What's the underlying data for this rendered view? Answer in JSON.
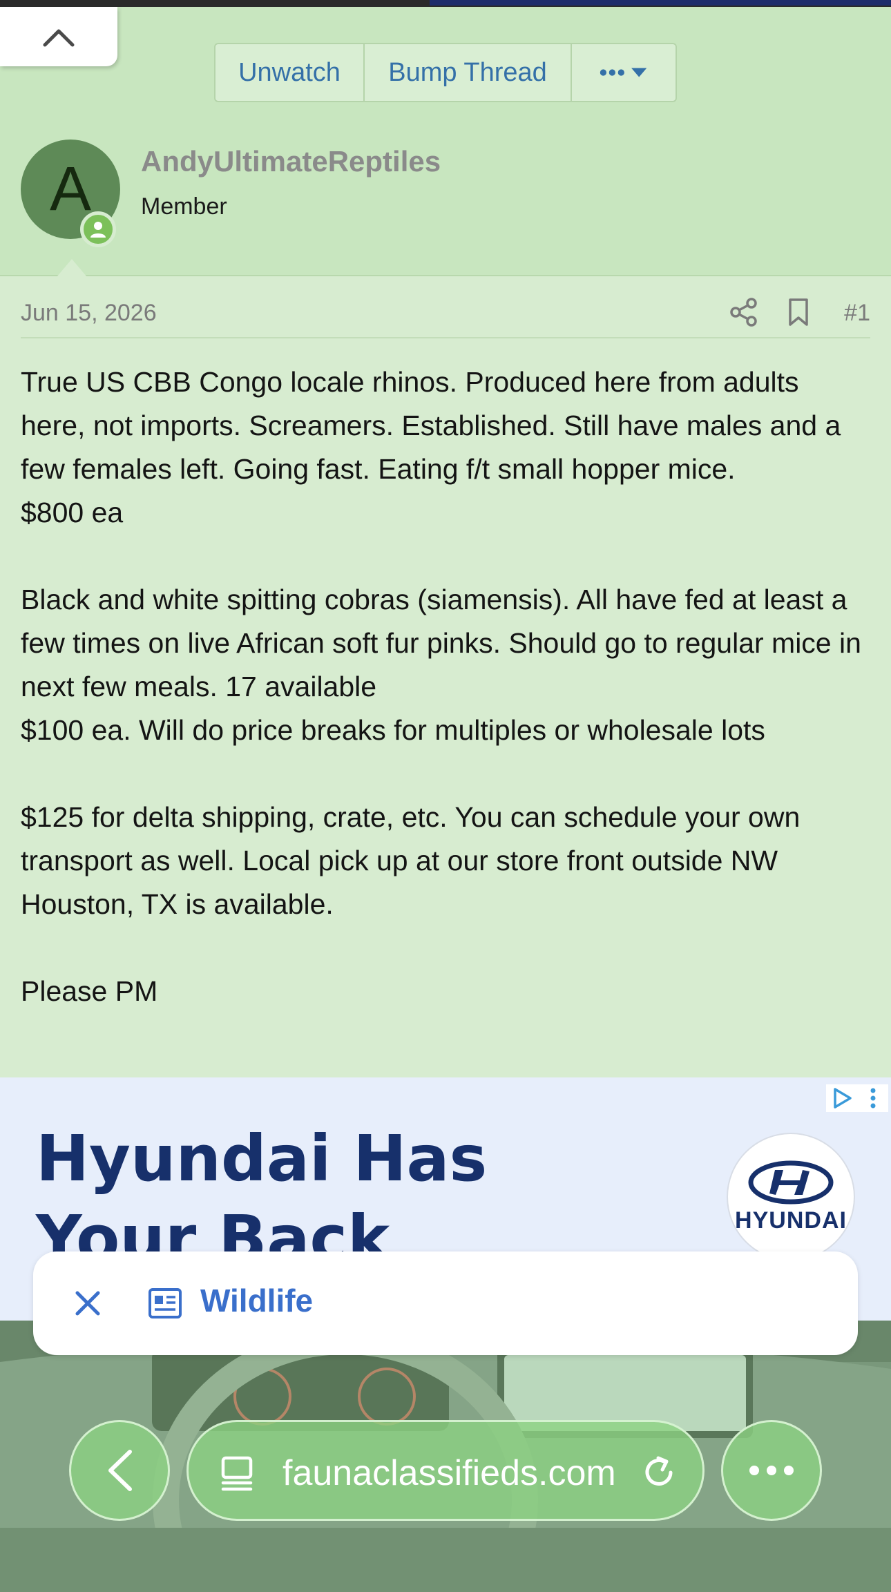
{
  "thread_actions": {
    "unwatch_label": "Unwatch",
    "bump_label": "Bump Thread",
    "more_icon": "ellipsis-dropdown-icon"
  },
  "post": {
    "author": {
      "avatar_letter": "A",
      "username": "AndyUltimateReptiles",
      "user_title": "Member",
      "avatar_color": "#5e8a57",
      "online_color": "#7cc05a"
    },
    "date": "Jun 15, 2026",
    "number": "#1",
    "paragraphs": [
      "True US CBB Congo locale rhinos. Produced here from adults here, not imports. Screamers. Established. Still have males and a few females left. Going fast. Eating f/t small hopper mice.",
      "$800 ea",
      "",
      "Black and white spitting cobras (siamensis). All have fed at least a few times on live African soft fur pinks. Should go to regular mice in next few meals. 17 available",
      "$100 ea. Will do price breaks for multiples or wholesale lots",
      "",
      "$125 for delta shipping, crate, etc. You can schedule your own transport as well. Local pick up at our store front outside NW Houston, TX is available.",
      "",
      "Please PM"
    ]
  },
  "ad": {
    "headline": "Hyundai Has Your Back",
    "brand_logo_text": "HYUNDAI",
    "brand_color": "#17306b"
  },
  "context_bar": {
    "label": "Wildlife",
    "accent": "#3a6fcb"
  },
  "browser": {
    "url": "faunaclassifieds.com"
  },
  "colors": {
    "page_bg": "#d7ecd0",
    "header_bg": "#c8e6bf",
    "link_blue": "#3470a8"
  }
}
